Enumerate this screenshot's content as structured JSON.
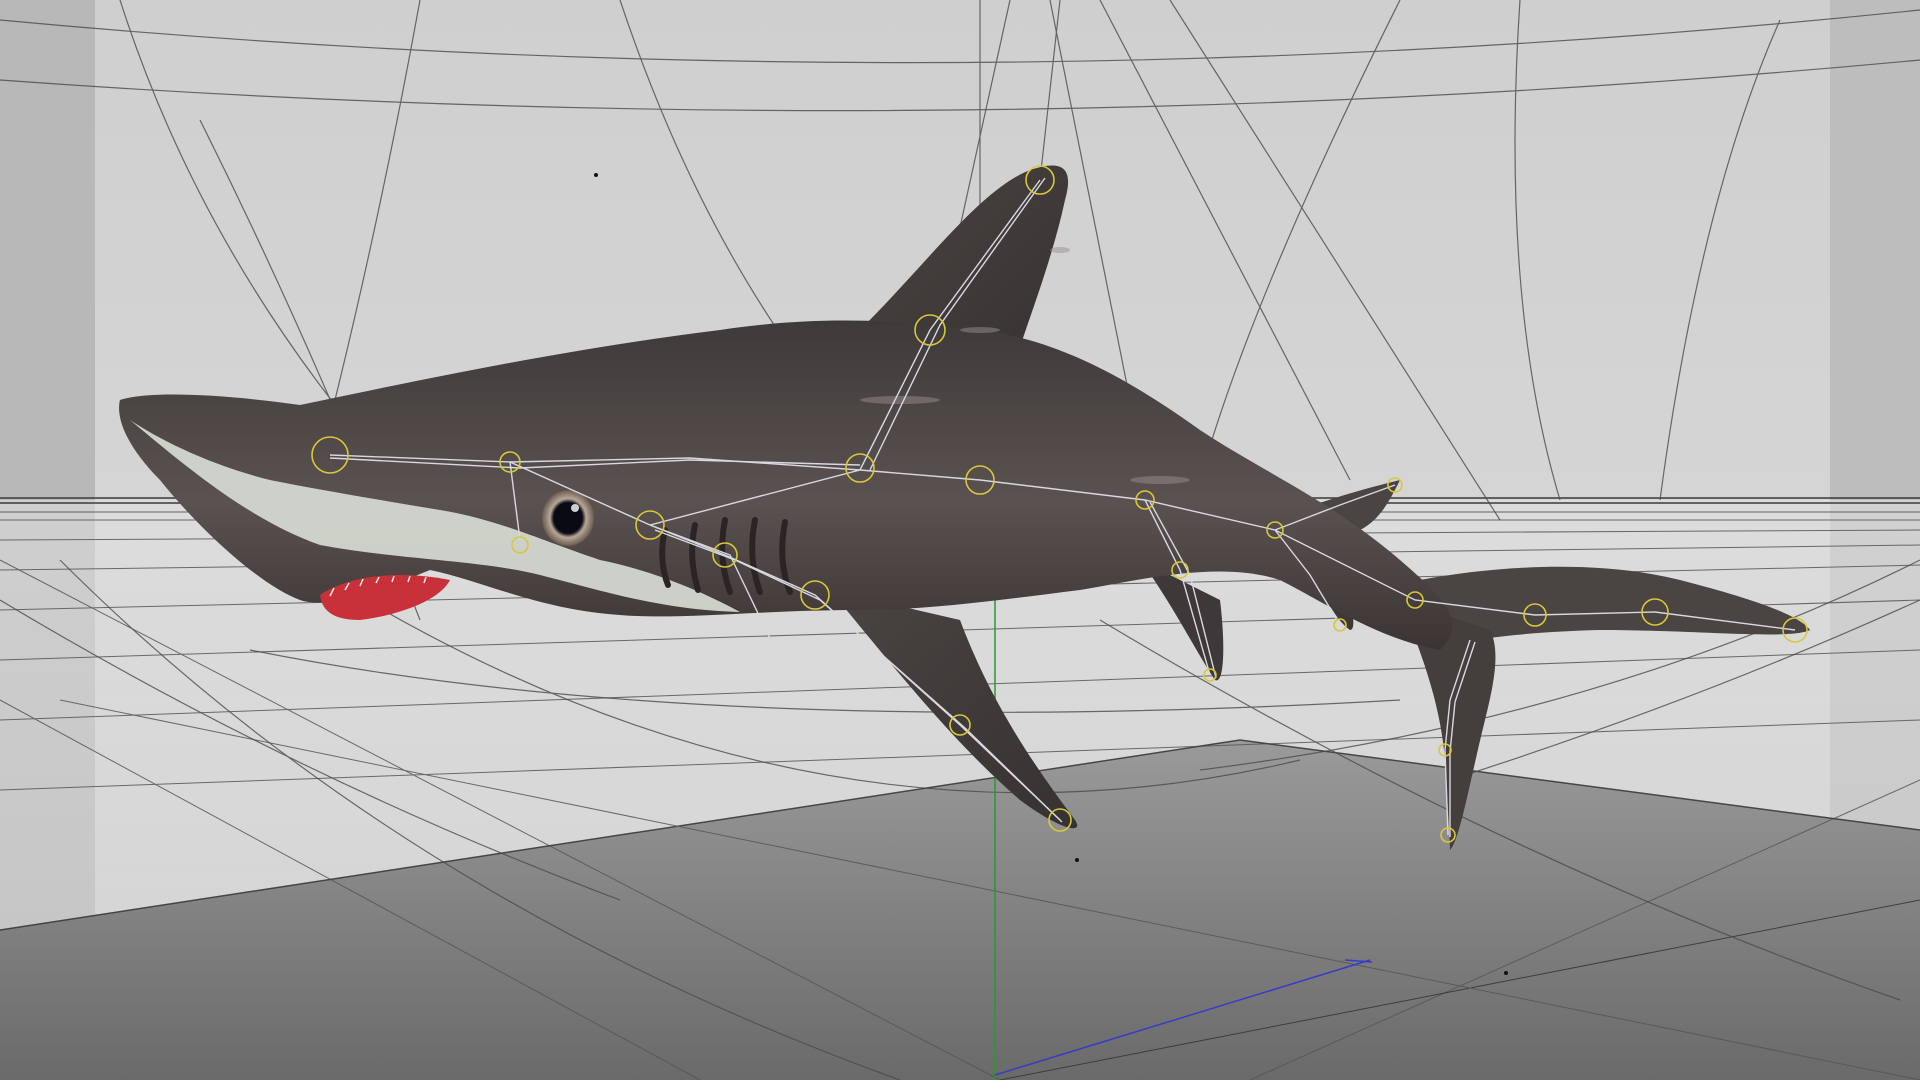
{
  "viewport": {
    "background_color": "#cfcfcf",
    "floor_color": "#8a8a8a",
    "wall_color": "#d4d4d4",
    "grid_line_color": "#555555",
    "horizon_line_color": "#3a3a3a"
  },
  "model": {
    "body_color": "#4a4442",
    "belly_color": "#d8dcd4",
    "mouth_color": "#c8303a",
    "eye_iris_color": "#b8a89a",
    "eye_pupil_color": "#0a0a14"
  },
  "rig": {
    "bone_color": "#d8d8e0",
    "joint_color": "#d8c83a"
  },
  "axes": {
    "y_axis_color": "#2a9a2a",
    "x_axis_color": "#3a3ac8"
  }
}
